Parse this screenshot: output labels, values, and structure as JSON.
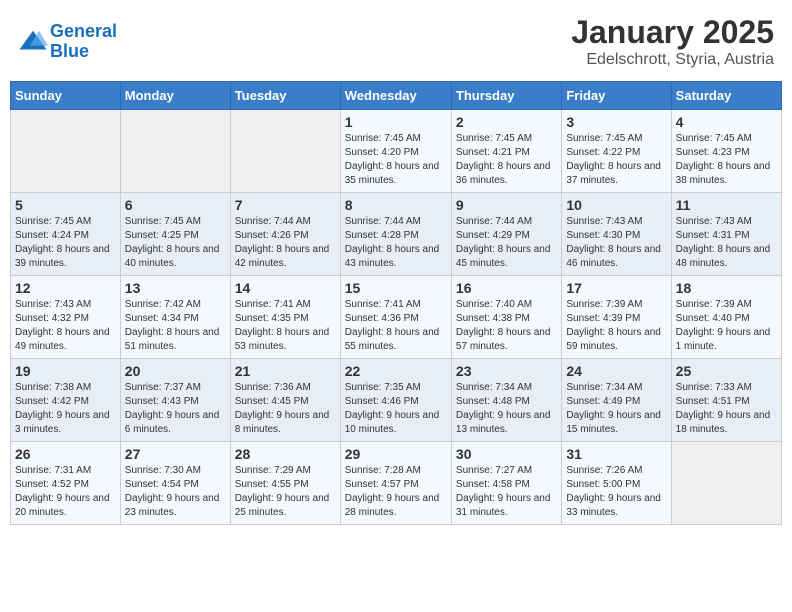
{
  "logo": {
    "line1": "General",
    "line2": "Blue"
  },
  "title": "January 2025",
  "subtitle": "Edelschrott, Styria, Austria",
  "days_of_week": [
    "Sunday",
    "Monday",
    "Tuesday",
    "Wednesday",
    "Thursday",
    "Friday",
    "Saturday"
  ],
  "weeks": [
    [
      {
        "day": "",
        "info": ""
      },
      {
        "day": "",
        "info": ""
      },
      {
        "day": "",
        "info": ""
      },
      {
        "day": "1",
        "info": "Sunrise: 7:45 AM\nSunset: 4:20 PM\nDaylight: 8 hours and 35 minutes."
      },
      {
        "day": "2",
        "info": "Sunrise: 7:45 AM\nSunset: 4:21 PM\nDaylight: 8 hours and 36 minutes."
      },
      {
        "day": "3",
        "info": "Sunrise: 7:45 AM\nSunset: 4:22 PM\nDaylight: 8 hours and 37 minutes."
      },
      {
        "day": "4",
        "info": "Sunrise: 7:45 AM\nSunset: 4:23 PM\nDaylight: 8 hours and 38 minutes."
      }
    ],
    [
      {
        "day": "5",
        "info": "Sunrise: 7:45 AM\nSunset: 4:24 PM\nDaylight: 8 hours and 39 minutes."
      },
      {
        "day": "6",
        "info": "Sunrise: 7:45 AM\nSunset: 4:25 PM\nDaylight: 8 hours and 40 minutes."
      },
      {
        "day": "7",
        "info": "Sunrise: 7:44 AM\nSunset: 4:26 PM\nDaylight: 8 hours and 42 minutes."
      },
      {
        "day": "8",
        "info": "Sunrise: 7:44 AM\nSunset: 4:28 PM\nDaylight: 8 hours and 43 minutes."
      },
      {
        "day": "9",
        "info": "Sunrise: 7:44 AM\nSunset: 4:29 PM\nDaylight: 8 hours and 45 minutes."
      },
      {
        "day": "10",
        "info": "Sunrise: 7:43 AM\nSunset: 4:30 PM\nDaylight: 8 hours and 46 minutes."
      },
      {
        "day": "11",
        "info": "Sunrise: 7:43 AM\nSunset: 4:31 PM\nDaylight: 8 hours and 48 minutes."
      }
    ],
    [
      {
        "day": "12",
        "info": "Sunrise: 7:43 AM\nSunset: 4:32 PM\nDaylight: 8 hours and 49 minutes."
      },
      {
        "day": "13",
        "info": "Sunrise: 7:42 AM\nSunset: 4:34 PM\nDaylight: 8 hours and 51 minutes."
      },
      {
        "day": "14",
        "info": "Sunrise: 7:41 AM\nSunset: 4:35 PM\nDaylight: 8 hours and 53 minutes."
      },
      {
        "day": "15",
        "info": "Sunrise: 7:41 AM\nSunset: 4:36 PM\nDaylight: 8 hours and 55 minutes."
      },
      {
        "day": "16",
        "info": "Sunrise: 7:40 AM\nSunset: 4:38 PM\nDaylight: 8 hours and 57 minutes."
      },
      {
        "day": "17",
        "info": "Sunrise: 7:39 AM\nSunset: 4:39 PM\nDaylight: 8 hours and 59 minutes."
      },
      {
        "day": "18",
        "info": "Sunrise: 7:39 AM\nSunset: 4:40 PM\nDaylight: 9 hours and 1 minute."
      }
    ],
    [
      {
        "day": "19",
        "info": "Sunrise: 7:38 AM\nSunset: 4:42 PM\nDaylight: 9 hours and 3 minutes."
      },
      {
        "day": "20",
        "info": "Sunrise: 7:37 AM\nSunset: 4:43 PM\nDaylight: 9 hours and 6 minutes."
      },
      {
        "day": "21",
        "info": "Sunrise: 7:36 AM\nSunset: 4:45 PM\nDaylight: 9 hours and 8 minutes."
      },
      {
        "day": "22",
        "info": "Sunrise: 7:35 AM\nSunset: 4:46 PM\nDaylight: 9 hours and 10 minutes."
      },
      {
        "day": "23",
        "info": "Sunrise: 7:34 AM\nSunset: 4:48 PM\nDaylight: 9 hours and 13 minutes."
      },
      {
        "day": "24",
        "info": "Sunrise: 7:34 AM\nSunset: 4:49 PM\nDaylight: 9 hours and 15 minutes."
      },
      {
        "day": "25",
        "info": "Sunrise: 7:33 AM\nSunset: 4:51 PM\nDaylight: 9 hours and 18 minutes."
      }
    ],
    [
      {
        "day": "26",
        "info": "Sunrise: 7:31 AM\nSunset: 4:52 PM\nDaylight: 9 hours and 20 minutes."
      },
      {
        "day": "27",
        "info": "Sunrise: 7:30 AM\nSunset: 4:54 PM\nDaylight: 9 hours and 23 minutes."
      },
      {
        "day": "28",
        "info": "Sunrise: 7:29 AM\nSunset: 4:55 PM\nDaylight: 9 hours and 25 minutes."
      },
      {
        "day": "29",
        "info": "Sunrise: 7:28 AM\nSunset: 4:57 PM\nDaylight: 9 hours and 28 minutes."
      },
      {
        "day": "30",
        "info": "Sunrise: 7:27 AM\nSunset: 4:58 PM\nDaylight: 9 hours and 31 minutes."
      },
      {
        "day": "31",
        "info": "Sunrise: 7:26 AM\nSunset: 5:00 PM\nDaylight: 9 hours and 33 minutes."
      },
      {
        "day": "",
        "info": ""
      }
    ]
  ]
}
